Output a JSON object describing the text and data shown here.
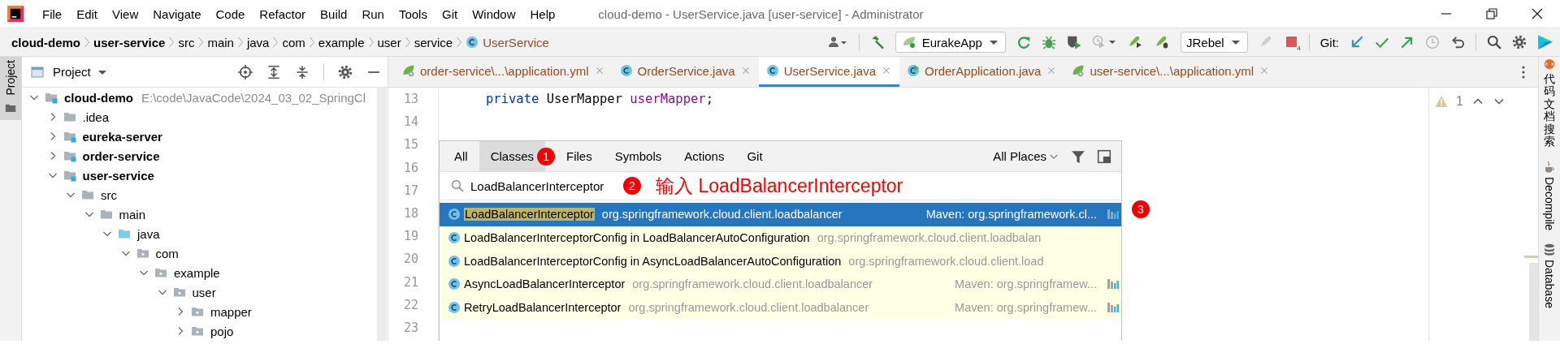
{
  "window": {
    "title": "cloud-demo - UserService.java [user-service] - Administrator"
  },
  "menu": [
    "File",
    "Edit",
    "View",
    "Navigate",
    "Code",
    "Refactor",
    "Build",
    "Run",
    "Tools",
    "Git",
    "Window",
    "Help"
  ],
  "breadcrumb": [
    {
      "label": "cloud-demo",
      "kind": "module"
    },
    {
      "label": "user-service",
      "kind": "module"
    },
    {
      "label": "src",
      "kind": "folder"
    },
    {
      "label": "main",
      "kind": "folder"
    },
    {
      "label": "java",
      "kind": "folder"
    },
    {
      "label": "com",
      "kind": "folder"
    },
    {
      "label": "example",
      "kind": "folder"
    },
    {
      "label": "user",
      "kind": "folder"
    },
    {
      "label": "service",
      "kind": "folder"
    },
    {
      "label": "UserService",
      "kind": "class"
    }
  ],
  "toolbar": {
    "run_configuration": "EurakeApp",
    "jrebel_configuration": "JRebel",
    "stop_count": "4",
    "git_label": "Git:"
  },
  "left_strip": {
    "label": "Project",
    "selected": true
  },
  "project_panel": {
    "title": "Project",
    "tree": [
      {
        "label": "cloud-demo",
        "kind": "project",
        "path": "E:\\code\\JavaCode\\2024_03_02_SpringCl",
        "expanded": true,
        "children": [
          {
            "label": ".idea",
            "kind": "folder",
            "expanded": false
          },
          {
            "label": "eureka-server",
            "kind": "module",
            "expanded": false
          },
          {
            "label": "order-service",
            "kind": "module",
            "expanded": false
          },
          {
            "label": "user-service",
            "kind": "module",
            "expanded": true,
            "children": [
              {
                "label": "src",
                "kind": "folder",
                "expanded": true,
                "children": [
                  {
                    "label": "main",
                    "kind": "folder",
                    "expanded": true,
                    "children": [
                      {
                        "label": "java",
                        "kind": "source",
                        "expanded": true,
                        "children": [
                          {
                            "label": "com",
                            "kind": "package",
                            "expanded": true,
                            "children": [
                              {
                                "label": "example",
                                "kind": "package",
                                "expanded": true,
                                "children": [
                                  {
                                    "label": "user",
                                    "kind": "package",
                                    "expanded": true,
                                    "children": [
                                      {
                                        "label": "mapper",
                                        "kind": "package",
                                        "expanded": false
                                      },
                                      {
                                        "label": "pojo",
                                        "kind": "package",
                                        "expanded": false
                                      }
                                    ]
                                  }
                                ]
                              }
                            ]
                          }
                        ]
                      }
                    ]
                  }
                ]
              }
            ]
          }
        ]
      }
    ]
  },
  "editor_tabs": [
    {
      "label": "order-service\\...\\application.yml",
      "kind": "yml",
      "selected": false
    },
    {
      "label": "OrderService.java",
      "kind": "class",
      "selected": false
    },
    {
      "label": "UserService.java",
      "kind": "class",
      "selected": true
    },
    {
      "label": "OrderApplication.java",
      "kind": "app",
      "selected": false
    },
    {
      "label": "user-service\\...\\application.yml",
      "kind": "yml",
      "selected": false
    }
  ],
  "editor": {
    "warning_count": "1",
    "lines": [
      {
        "number": "13",
        "tokens": [
          {
            "text": "private",
            "kind": "keyword"
          },
          {
            "text": " UserMapper ",
            "kind": "plain"
          },
          {
            "text": "userMapper",
            "kind": "field"
          },
          {
            "text": ";",
            "kind": "plain"
          }
        ]
      },
      {
        "number": "14"
      },
      {
        "number": "15"
      },
      {
        "number": "16"
      },
      {
        "number": "17"
      },
      {
        "number": "18"
      },
      {
        "number": "19"
      },
      {
        "number": "20"
      },
      {
        "number": "21"
      },
      {
        "number": "22"
      },
      {
        "number": "23"
      }
    ]
  },
  "search_popup": {
    "tabs": [
      {
        "label": "All",
        "selected": false
      },
      {
        "label": "Classes",
        "selected": true
      },
      {
        "label": "Files",
        "selected": false
      },
      {
        "label": "Symbols",
        "selected": false
      },
      {
        "label": "Actions",
        "selected": false
      },
      {
        "label": "Git",
        "selected": false
      }
    ],
    "scope": "All Places",
    "query": "LoadBalancerInterceptor",
    "results": [
      {
        "name": "LoadBalancerInterceptor",
        "location": "org.springframework.cloud.client.loadbalancer",
        "library": "Maven: org.springframework.cl...",
        "selected": true
      },
      {
        "name": "LoadBalancerInterceptorConfig in LoadBalancerAutoConfiguration",
        "location": "org.springframework.cloud.client.loadbalan",
        "selected": false
      },
      {
        "name": "LoadBalancerInterceptorConfig in AsyncLoadBalancerAutoConfiguration",
        "location": "org.springframework.cloud.client.load",
        "selected": false
      },
      {
        "name": "AsyncLoadBalancerInterceptor",
        "location": "org.springframework.cloud.client.loadbalancer",
        "library": "Maven: org.springframew...",
        "selected": false
      },
      {
        "name": "RetryLoadBalancerInterceptor",
        "location": "org.springframework.cloud.client.loadbalancer",
        "library": "Maven: org.springframew...",
        "selected": false
      }
    ]
  },
  "annotations": {
    "badges": [
      "1",
      "2",
      "3"
    ],
    "note": "输入 LoadBalancerInterceptor"
  },
  "right_strip": [
    {
      "label": "代码文档搜索",
      "kind": "cjk"
    },
    {
      "label": "Decompile",
      "kind": "decompile"
    },
    {
      "label": "Database",
      "kind": "database"
    }
  ]
}
